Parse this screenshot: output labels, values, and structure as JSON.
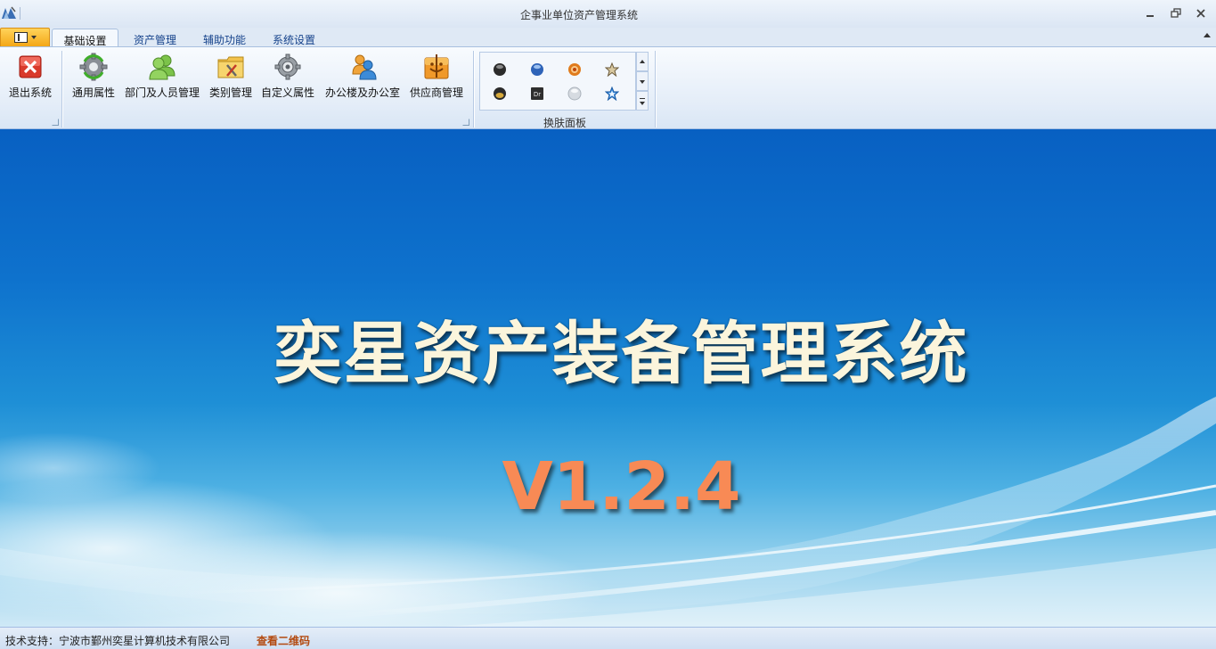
{
  "window": {
    "title": "企事业单位资产管理系统"
  },
  "ribbon_tabs": [
    {
      "label": "基础设置",
      "active": true
    },
    {
      "label": "资产管理",
      "active": false
    },
    {
      "label": "辅助功能",
      "active": false
    },
    {
      "label": "系统设置",
      "active": false
    }
  ],
  "ribbon": {
    "buttons": [
      {
        "label": "退出系统",
        "icon": "exit-x-icon"
      },
      {
        "label": "通用属性",
        "icon": "gear-refresh-icon"
      },
      {
        "label": "部门及人员管理",
        "icon": "users-icon"
      },
      {
        "label": "类别管理",
        "icon": "folder-tools-icon"
      },
      {
        "label": "自定义属性",
        "icon": "settings-gear-icon"
      },
      {
        "label": "办公楼及办公室",
        "icon": "people-group-icon"
      },
      {
        "label": "供应商管理",
        "icon": "supplier-icon"
      }
    ],
    "skin_gallery": {
      "label": "换肤面板",
      "items": [
        "black-orb",
        "blue-orb",
        "orange-ring",
        "brown-star",
        "dark-gold-orb",
        "dr-skin",
        "silver-orb",
        "blue-star"
      ]
    }
  },
  "main": {
    "title": "奕星资产装备管理系统",
    "version": "V1.2.4"
  },
  "statusbar": {
    "support_text": "技术支持：宁波市鄞州奕星计算机技术有限公司",
    "qr_link": "查看二维码"
  },
  "colors": {
    "title_text": "#fbf5dc",
    "version_text": "#f88a55",
    "qr_link": "#b34a10"
  }
}
